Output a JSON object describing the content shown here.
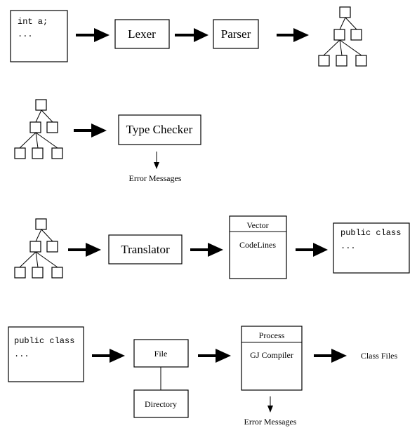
{
  "row1": {
    "code_line1": "int a;",
    "code_line2": "...",
    "lexer": "Lexer",
    "parser": "Parser"
  },
  "row2": {
    "type_checker": "Type Checker",
    "errors": "Error Messages"
  },
  "row3": {
    "translator": "Translator",
    "vector_title": "Vector",
    "vector_content": "CodeLines",
    "code_line1": "public class",
    "code_line2": "..."
  },
  "row4": {
    "code_line1": "public class",
    "code_line2": "...",
    "file": "File",
    "directory": "Directory",
    "process_title": "Process",
    "process_content": "GJ Compiler",
    "errors": "Error Messages",
    "output": "Class Files"
  }
}
